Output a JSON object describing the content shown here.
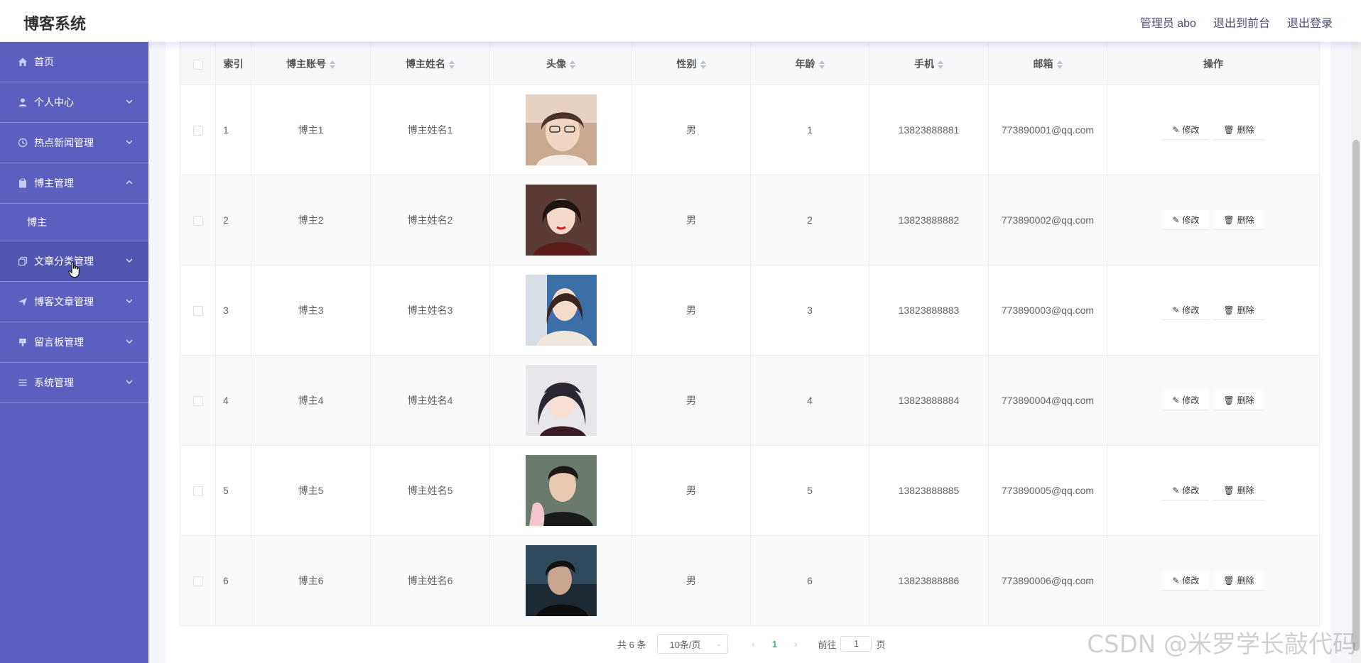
{
  "app": {
    "title": "博客系统"
  },
  "header": {
    "links": [
      "管理员 abo",
      "退出到前台",
      "退出登录"
    ]
  },
  "sidebar": {
    "items": [
      {
        "label": "首页",
        "icon": "home-icon",
        "has_children": false
      },
      {
        "label": "个人中心",
        "icon": "user-icon",
        "has_children": true,
        "expanded": false
      },
      {
        "label": "热点新闻管理",
        "icon": "clock-icon",
        "has_children": true,
        "expanded": false
      },
      {
        "label": "博主管理",
        "icon": "clipboard-icon",
        "has_children": true,
        "expanded": true,
        "children": [
          "博主"
        ]
      },
      {
        "label": "文章分类管理",
        "icon": "copy-icon",
        "has_children": true,
        "expanded": false
      },
      {
        "label": "博客文章管理",
        "icon": "send-icon",
        "has_children": true,
        "expanded": false
      },
      {
        "label": "留言板管理",
        "icon": "board-icon",
        "has_children": true,
        "expanded": false
      },
      {
        "label": "系统管理",
        "icon": "list-icon",
        "has_children": true,
        "expanded": false
      }
    ]
  },
  "table": {
    "columns": [
      "索引",
      "博主账号",
      "博主姓名",
      "头像",
      "性别",
      "年龄",
      "手机",
      "邮箱",
      "操作"
    ],
    "rows": [
      {
        "index": "1",
        "account": "博主1",
        "name": "博主姓名1",
        "gender": "男",
        "age": "1",
        "phone": "13823888881",
        "email": "773890001@qq.com"
      },
      {
        "index": "2",
        "account": "博主2",
        "name": "博主姓名2",
        "gender": "男",
        "age": "2",
        "phone": "13823888882",
        "email": "773890002@qq.com"
      },
      {
        "index": "3",
        "account": "博主3",
        "name": "博主姓名3",
        "gender": "男",
        "age": "3",
        "phone": "13823888883",
        "email": "773890003@qq.com"
      },
      {
        "index": "4",
        "account": "博主4",
        "name": "博主姓名4",
        "gender": "男",
        "age": "4",
        "phone": "13823888884",
        "email": "773890004@qq.com"
      },
      {
        "index": "5",
        "account": "博主5",
        "name": "博主姓名5",
        "gender": "男",
        "age": "5",
        "phone": "13823888885",
        "email": "773890005@qq.com"
      },
      {
        "index": "6",
        "account": "博主6",
        "name": "博主姓名6",
        "gender": "男",
        "age": "6",
        "phone": "13823888886",
        "email": "773890006@qq.com"
      }
    ],
    "actions": {
      "edit": "修改",
      "delete": "删除"
    }
  },
  "pagination": {
    "total_text": "共 6 条",
    "page_size": "10条/页",
    "current_page": "1",
    "goto_label": "前往",
    "goto_value": "1",
    "page_unit": "页"
  },
  "watermark": "CSDN @米罗学长敲代码",
  "colors": {
    "sidebar": "#5c5fbd",
    "accent_page": "#3bb56c"
  }
}
